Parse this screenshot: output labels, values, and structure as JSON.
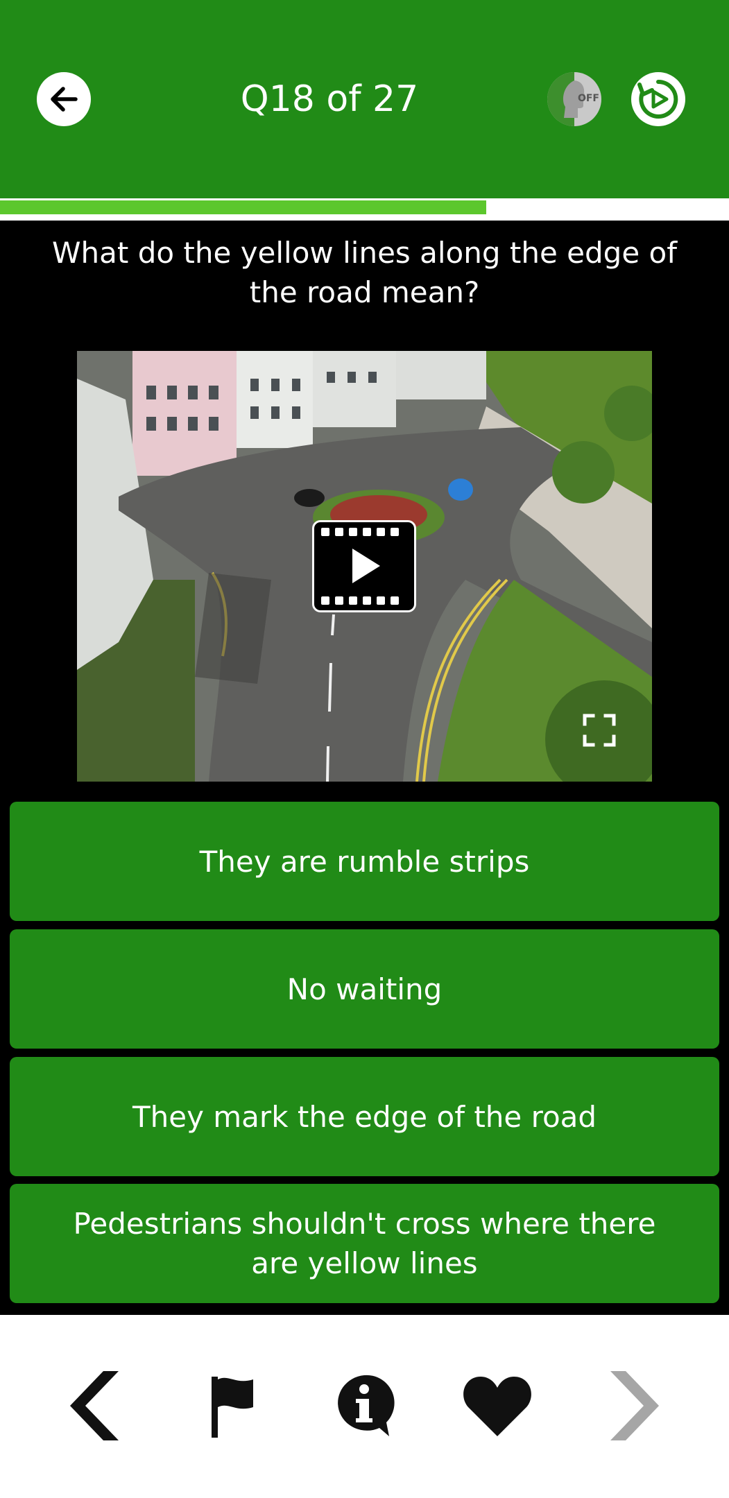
{
  "header": {
    "title": "Q18 of 27",
    "back_icon": "arrow-left-icon",
    "voice_toggle": {
      "state": "OFF",
      "icon": "voice-head-icon"
    },
    "replay_icon": "replay-video-icon"
  },
  "progress": {
    "current": 18,
    "total": 27,
    "fraction": 0.667
  },
  "question": {
    "text": "What do the yellow lines along the edge of the road mean?"
  },
  "media": {
    "type": "video",
    "description_icon": "play-video-icon",
    "fullscreen_icon": "expand-icon"
  },
  "answers": [
    {
      "label": "They are rumble strips"
    },
    {
      "label": "No waiting"
    },
    {
      "label": "They mark the edge of the road"
    },
    {
      "label": "Pedestrians shouldn't cross where there are yellow lines"
    }
  ],
  "bottom_nav": {
    "items": [
      {
        "icon": "chevron-left-icon",
        "enabled": true
      },
      {
        "icon": "flag-icon",
        "enabled": true
      },
      {
        "icon": "info-icon",
        "enabled": true
      },
      {
        "icon": "heart-icon",
        "enabled": true
      },
      {
        "icon": "chevron-right-icon",
        "enabled": false
      }
    ]
  },
  "colors": {
    "primary_green": "#218b17",
    "progress_green": "#5cc72d",
    "background": "#000000",
    "disabled_gray": "#a6a6a6"
  }
}
